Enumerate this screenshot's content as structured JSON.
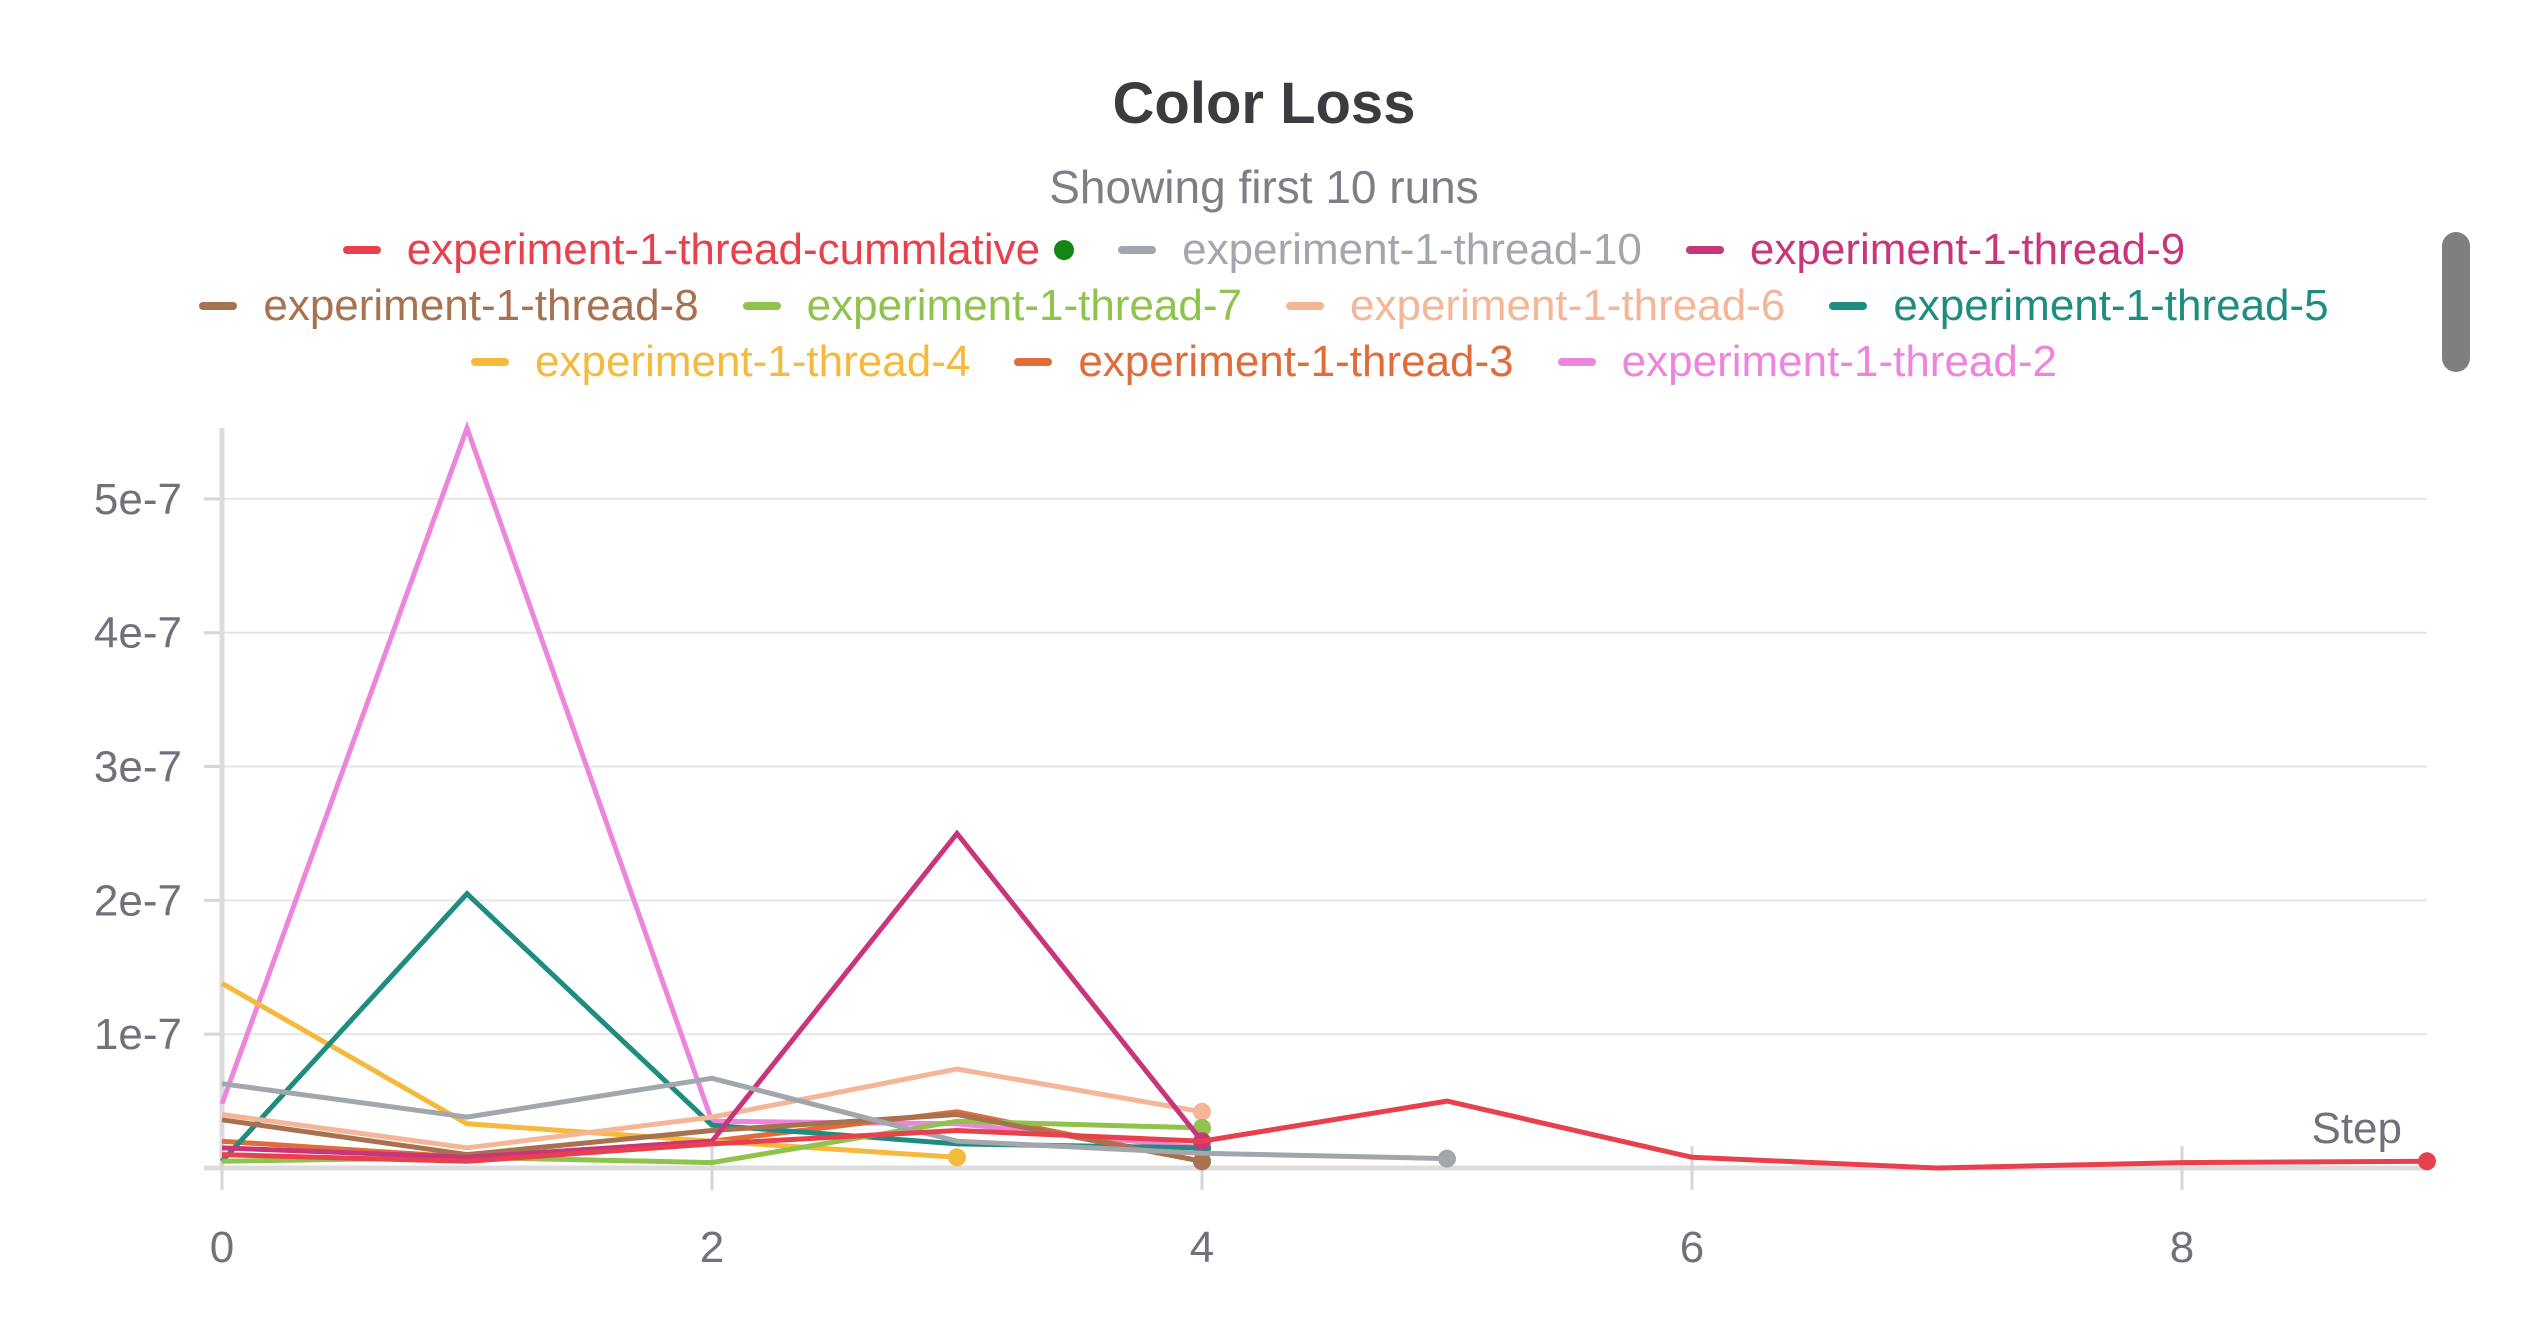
{
  "chart_data": {
    "type": "line",
    "title": "Color Loss",
    "subtitle": "Showing first 10 runs",
    "xlabel": "Step",
    "ylabel": "",
    "xlim": [
      0,
      9
    ],
    "ylim": [
      0,
      5.5e-07
    ],
    "x_ticks": [
      0,
      2,
      4,
      6,
      8
    ],
    "x_tick_labels": [
      "0",
      "2",
      "4",
      "6",
      "8"
    ],
    "y_ticks": [
      1e-07,
      2e-07,
      3e-07,
      4e-07,
      5e-07
    ],
    "y_tick_labels": [
      "1e-7",
      "2e-7",
      "3e-7",
      "4e-7",
      "5e-7"
    ],
    "grid": true,
    "legend_position": "top",
    "series": [
      {
        "name": "experiment-1-thread-cummlative",
        "color": "#e8414d",
        "active": true,
        "x": [
          0,
          1,
          2,
          3,
          4,
          5,
          6,
          7,
          8,
          9
        ],
        "y": [
          1e-08,
          5e-09,
          1.8e-08,
          2.8e-08,
          2e-08,
          5e-08,
          8e-09,
          0.0,
          4e-09,
          5e-09
        ]
      },
      {
        "name": "experiment-1-thread-10",
        "color": "#a2a6ad",
        "x": [
          0,
          1,
          2,
          3,
          4,
          5
        ],
        "y": [
          6.3e-08,
          3.8e-08,
          6.7e-08,
          2e-08,
          1.1e-08,
          7e-09
        ]
      },
      {
        "name": "experiment-1-thread-9",
        "color": "#c9357a",
        "x": [
          0,
          1,
          2,
          3,
          4
        ],
        "y": [
          1.5e-08,
          8e-09,
          2e-08,
          2.5e-07,
          2e-08
        ]
      },
      {
        "name": "experiment-1-thread-8",
        "color": "#a8714f",
        "x": [
          0,
          1,
          2,
          3,
          4
        ],
        "y": [
          3.6e-08,
          1e-08,
          2.8e-08,
          4e-08,
          5e-09
        ]
      },
      {
        "name": "experiment-1-thread-7",
        "color": "#8fc34b",
        "x": [
          0,
          1,
          2,
          3,
          4
        ],
        "y": [
          5e-09,
          8e-09,
          4e-09,
          3.5e-08,
          3e-08
        ]
      },
      {
        "name": "experiment-1-thread-6",
        "color": "#f5b698",
        "x": [
          0,
          1,
          2,
          3,
          4
        ],
        "y": [
          4e-08,
          1.5e-08,
          3.8e-08,
          7.4e-08,
          4.2e-08
        ]
      },
      {
        "name": "experiment-1-thread-5",
        "color": "#1e8c7e",
        "x": [
          0,
          1,
          2,
          3,
          4
        ],
        "y": [
          5e-09,
          2.05e-07,
          3.2e-08,
          1.8e-08,
          1.5e-08
        ]
      },
      {
        "name": "experiment-1-thread-4",
        "color": "#f5b93d",
        "x": [
          0,
          1,
          2,
          3
        ],
        "y": [
          1.38e-07,
          3.3e-08,
          2e-08,
          8e-09
        ]
      },
      {
        "name": "experiment-1-thread-3",
        "color": "#e06c3a",
        "x": [
          0,
          1,
          2,
          3,
          4
        ],
        "y": [
          2e-08,
          8e-09,
          2e-08,
          4.2e-08,
          5e-09
        ]
      },
      {
        "name": "experiment-1-thread-2",
        "color": "#ee85dc",
        "x": [
          0,
          1,
          2,
          3,
          4
        ],
        "y": [
          4.8e-08,
          5.53e-07,
          3.5e-08,
          3.3e-08,
          1.5e-08
        ]
      }
    ]
  },
  "legend_rows": [
    [
      0,
      1,
      2
    ],
    [
      3,
      4,
      5,
      6
    ],
    [
      7,
      8,
      9
    ]
  ]
}
